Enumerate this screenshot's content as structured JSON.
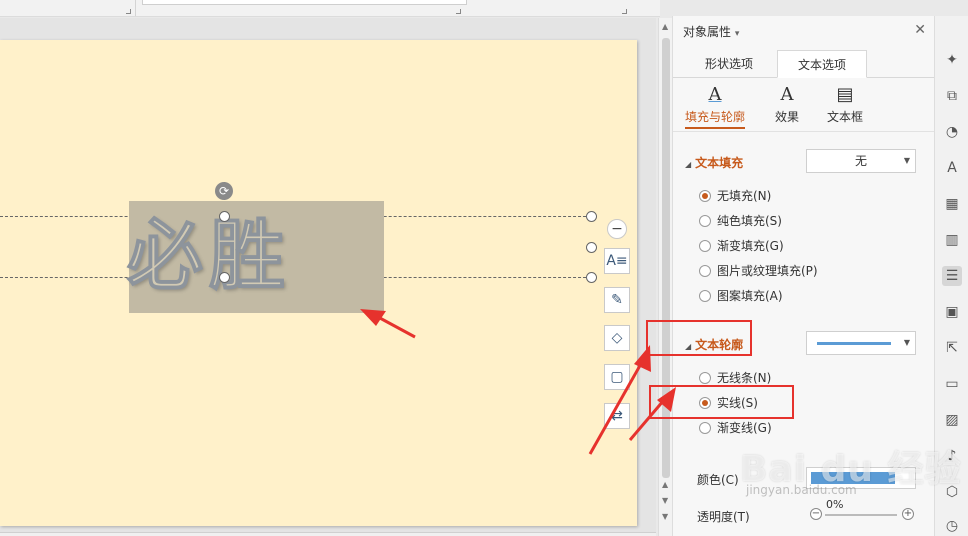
{
  "slide": {
    "text": "必胜",
    "background": "#fff1ca"
  },
  "panel": {
    "title": "对象属性",
    "title_caret": "▾",
    "close_icon": "✕",
    "tabs": [
      {
        "label": "形状选项"
      },
      {
        "label": "文本选项",
        "active": true
      }
    ],
    "subtabs": [
      {
        "label": "填充与轮廓",
        "icon": "A",
        "active": true
      },
      {
        "label": "效果",
        "icon": "A"
      },
      {
        "label": "文本框",
        "icon": "▤"
      }
    ],
    "fill_section": {
      "title": "文本填充",
      "dropdown_value": "无",
      "options": [
        {
          "label": "无填充(N)",
          "selected": true
        },
        {
          "label": "纯色填充(S)"
        },
        {
          "label": "渐变填充(G)"
        },
        {
          "label": "图片或纹理填充(P)"
        },
        {
          "label": "图案填充(A)"
        }
      ]
    },
    "outline_section": {
      "title": "文本轮廓",
      "options": [
        {
          "label": "无线条(N)"
        },
        {
          "label": "实线(S)",
          "selected": true
        },
        {
          "label": "渐变线(G)"
        }
      ]
    },
    "color_label": "颜色(C)",
    "color_value": "#5b9bd5",
    "transparency_label": "透明度(T)",
    "transparency_value": "0%"
  },
  "float_tools": [
    "minus-icon",
    "text-layout-icon",
    "pen-icon",
    "fill-icon",
    "outline-icon",
    "replace-icon"
  ],
  "iconbar": [
    "pin-icon",
    "copy-icon",
    "shapes-icon",
    "text-icon",
    "grid-icon",
    "chart-icon",
    "settings-icon",
    "image-icon",
    "share-icon",
    "archive-icon",
    "picture-icon",
    "sound-icon",
    "shield-icon",
    "history-icon"
  ],
  "watermark": {
    "text": "Bai du 经验",
    "sub": "jingyan.baidu.com"
  },
  "colors": {
    "accent": "#c75a1c",
    "annotation": "#e6322d"
  }
}
